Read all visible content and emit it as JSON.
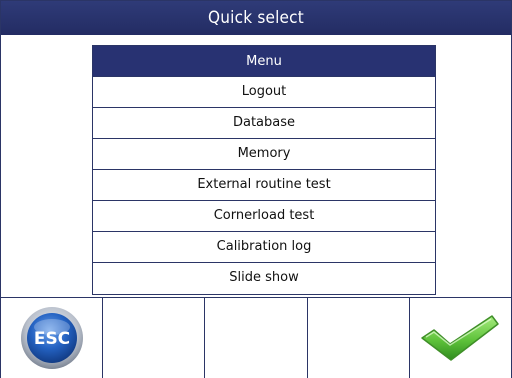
{
  "window": {
    "title": "Quick select"
  },
  "menu": {
    "header": "Menu",
    "items": [
      {
        "label": "Logout"
      },
      {
        "label": "Database"
      },
      {
        "label": "Memory"
      },
      {
        "label": "External routine test"
      },
      {
        "label": "Cornerload test"
      },
      {
        "label": "Calibration log"
      },
      {
        "label": "Slide show"
      }
    ]
  },
  "softkeys": {
    "esc_label": "ESC",
    "keys": [
      {
        "icon": "esc-icon"
      },
      {
        "icon": ""
      },
      {
        "icon": ""
      },
      {
        "icon": ""
      },
      {
        "icon": "checkmark-icon"
      }
    ]
  },
  "colors": {
    "titlebar": "#283272",
    "border": "#2b3566",
    "esc_blue": "#1f5fb8",
    "check_green": "#5ec23a"
  }
}
